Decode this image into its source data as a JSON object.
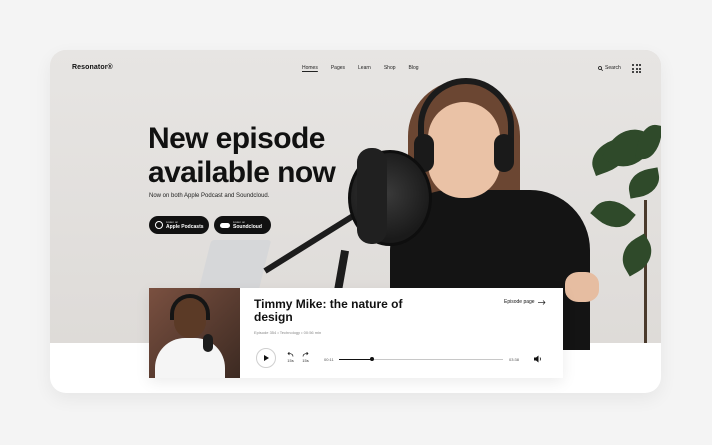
{
  "brand": "Resonator®",
  "nav": {
    "items": [
      "Homes",
      "Pages",
      "Learn",
      "Shop",
      "Blog"
    ],
    "search_label": "Search"
  },
  "hero": {
    "headline": "New episode\navailable now",
    "subline": "Now on both Apple Podcast and Soundcloud.",
    "buttons": [
      {
        "small": "Listen on",
        "label": "Apple Podcasts"
      },
      {
        "small": "Listen on",
        "label": "Soundcloud"
      }
    ]
  },
  "player": {
    "title": "Timmy Mike: the nature of design",
    "meta": "Episode 354 • Technology • 00:56 min",
    "episode_link": "Episode page",
    "back_label": "15s",
    "forward_label": "15s",
    "current_time": "00:11",
    "total_time": "03:38",
    "progress": 0.2
  },
  "colors": {
    "accent": "#111111",
    "hero_bg": "#e3e1df"
  },
  "icons": [
    "search-icon",
    "grid-menu-icon",
    "podcast-icon",
    "cloud-icon",
    "play-icon",
    "rewind-icon",
    "forward-icon",
    "volume-icon",
    "arrow-right-icon"
  ]
}
